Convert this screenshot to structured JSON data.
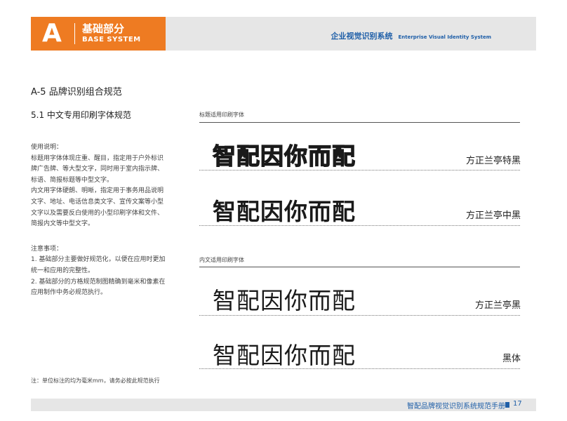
{
  "header": {
    "letter": "A",
    "section_cn": "基础部分",
    "section_en": "BASE SYSTEM",
    "system_cn": "企业视觉识别系统",
    "system_en": "Enterprise Visual Identity System"
  },
  "page": {
    "title": "A-5  品牌识别组合规范",
    "subtitle": "5.1  中文专用印刷字体规范"
  },
  "usage": {
    "heading": "使用说明：",
    "body1": "标题用字体体现庄重、醒目，指定用于户外标识牌广告牌、等大型文字，同时用于室内指示牌、标语、简报标题等中型文字。",
    "body2": "内文用字体硬朗、明晰，指定用于事务用品说明文字、地址、电话信息类文字、宣传文案等小型文字以及需要反白使用的小型印刷字体和文件、简报内文等中型文字。"
  },
  "notes": {
    "heading": "注意事项：",
    "item1": "1. 基础部分主要做好规范化，以便在应用时更加统一和应用的完整性。",
    "item2": "2. 基础部分的方格规范制图精确到毫米和像素在应用制作中务必规范执行。"
  },
  "footnote": "注：单位标注的均为毫米mm，请务必按此规范执行",
  "title_fonts": {
    "label": "标题适用印刷字体",
    "samples": [
      {
        "text": "智配因你而配",
        "font": "方正兰亭特黑"
      },
      {
        "text": "智配因你而配",
        "font": "方正兰亭中黑"
      }
    ]
  },
  "body_fonts": {
    "label": "内文适用印刷字体",
    "samples": [
      {
        "text": "智配因你而配",
        "font": "方正兰亭黑"
      },
      {
        "text": "智配因你而配",
        "font": "黑体"
      }
    ]
  },
  "footer": {
    "manual_title": "智配品牌视觉识别系统规范手册",
    "page_number": "17"
  },
  "colors": {
    "brand_orange": "#ee7b22",
    "brand_blue": "#1f5fa8",
    "bar_gray": "#e6e6e6"
  }
}
